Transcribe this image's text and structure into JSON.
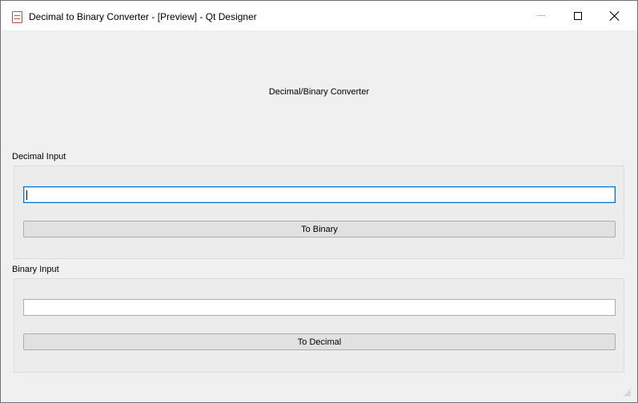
{
  "window": {
    "title": "Decimal to Binary Converter - [Preview] - Qt Designer",
    "icon": "qt-designer-app-icon",
    "controls": [
      "minimize-icon",
      "maximize-icon",
      "close-icon"
    ]
  },
  "form": {
    "heading": "Decimal/Binary Converter",
    "decimal_group": {
      "label": "Decimal Input",
      "input_value": "",
      "button_label": "To Binary"
    },
    "binary_group": {
      "label": "Binary Input",
      "input_value": "",
      "button_label": "To Decimal"
    }
  },
  "colors": {
    "window_bg": "#f0f0f0",
    "focus_border": "#0078d7",
    "button_bg": "#e1e1e1"
  }
}
